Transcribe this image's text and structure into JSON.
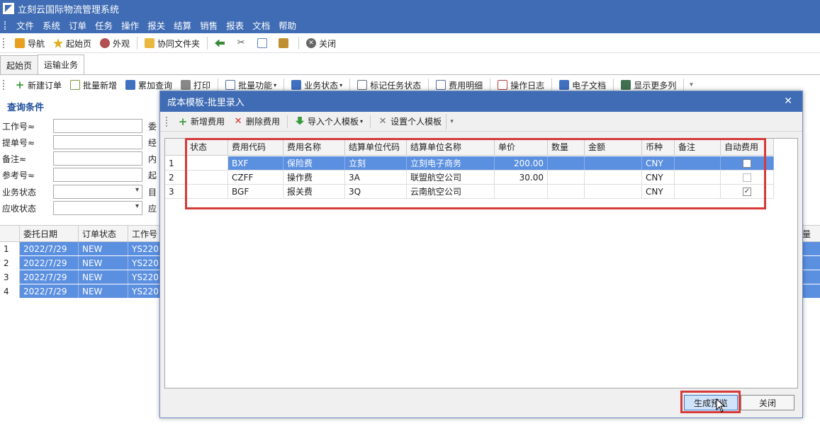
{
  "app": {
    "title": "立刻云国际物流管理系统",
    "menu": [
      "文件",
      "系统",
      "订单",
      "任务",
      "操作",
      "报关",
      "结算",
      "销售",
      "报表",
      "文档",
      "帮助"
    ]
  },
  "toolbar1": {
    "items": [
      {
        "label": "导航",
        "icon": "navigation-icon",
        "color": "#e8a020"
      },
      {
        "label": "起始页",
        "icon": "star-icon",
        "color": "#e0b020"
      },
      {
        "label": "外观",
        "icon": "palette-icon",
        "color": "#b05050"
      },
      {
        "label": "协同文件夹",
        "icon": "folder-icon",
        "color": "#e8b840"
      },
      {
        "label": "",
        "icon": "undo-icon",
        "color": "#3a8a3a"
      },
      {
        "label": "",
        "icon": "cut-icon",
        "color": "#555555"
      },
      {
        "label": "",
        "icon": "copy-icon",
        "color": "#6080c0"
      },
      {
        "label": "",
        "icon": "paste-icon",
        "color": "#c09030"
      },
      {
        "label": "关闭",
        "icon": "close-circle-icon",
        "color": "#666666"
      }
    ]
  },
  "tabs": [
    {
      "label": "起始页",
      "active": false
    },
    {
      "label": "运输业务",
      "active": true
    }
  ],
  "toolbar2": {
    "items": [
      {
        "label": "新建订单",
        "icon": "add-icon",
        "color": "#3a9a3a"
      },
      {
        "label": "批量新增",
        "icon": "batch-add-icon",
        "color": "#7a9a3a"
      },
      {
        "label": "累加查询",
        "icon": "search-icon",
        "color": "#4070c0"
      },
      {
        "label": "打印",
        "icon": "print-icon",
        "color": "#666666"
      },
      {
        "label": "批量功能",
        "icon": "batch-icon",
        "color": "#5070a0",
        "dropdown": true
      },
      {
        "label": "业务状态",
        "icon": "status-icon",
        "color": "#4070c0",
        "dropdown": true
      },
      {
        "label": "标记任务状态",
        "icon": "mark-icon",
        "color": "#607080"
      },
      {
        "label": "费用明细",
        "icon": "fee-detail-icon",
        "color": "#5070a0"
      },
      {
        "label": "操作日志",
        "icon": "log-icon",
        "color": "#c04040"
      },
      {
        "label": "电子文档",
        "icon": "document-icon",
        "color": "#4070c0"
      },
      {
        "label": "显示更多列",
        "icon": "columns-icon",
        "color": "#407050"
      }
    ]
  },
  "query": {
    "title": "查询条件",
    "rows": [
      {
        "label": "工作号≈",
        "label2": "委",
        "dropdown": false
      },
      {
        "label": "提单号≈",
        "label2": "经",
        "dropdown": false
      },
      {
        "label": "备注≈",
        "label2": "内",
        "dropdown": false
      },
      {
        "label": "参考号≈",
        "label2": "起",
        "dropdown": false
      },
      {
        "label": "业务状态",
        "label2": "目",
        "dropdown": true
      },
      {
        "label": "应收状态",
        "label2": "应",
        "dropdown": true
      }
    ]
  },
  "main_grid": {
    "headers": [
      "委托日期",
      "订单状态",
      "工作号"
    ],
    "right_header": "量",
    "rows": [
      {
        "n": "1",
        "date": "2022/7/29",
        "status": "NEW",
        "job": "YS220"
      },
      {
        "n": "2",
        "date": "2022/7/29",
        "status": "NEW",
        "job": "YS220"
      },
      {
        "n": "3",
        "date": "2022/7/29",
        "status": "NEW",
        "job": "YS220"
      },
      {
        "n": "4",
        "date": "2022/7/29",
        "status": "NEW",
        "job": "YS220"
      }
    ]
  },
  "dialog": {
    "title": "成本模板-批里录入",
    "close": "✕",
    "toolbar": [
      {
        "label": "新增费用",
        "icon": "add-icon",
        "color": "#3a9a3a"
      },
      {
        "label": "删除费用",
        "icon": "delete-icon",
        "color": "#d03030"
      },
      {
        "label": "导入个人模板",
        "icon": "import-icon",
        "color": "#3a9a3a",
        "dropdown": true
      },
      {
        "label": "设置个人模板",
        "icon": "settings-icon",
        "color": "#707070"
      }
    ],
    "columns": [
      "状态",
      "费用代码",
      "费用名称",
      "结算单位代码",
      "结算单位名称",
      "单价",
      "数量",
      "金额",
      "币种",
      "备注",
      "自动费用"
    ],
    "rows": [
      {
        "n": "1",
        "status": "",
        "code": "BXF",
        "name": "保险费",
        "unit_code": "立刻",
        "unit_name": "立刻电子商务",
        "price": "200.00",
        "qty": "",
        "amount": "",
        "currency": "CNY",
        "remark": "",
        "auto": false,
        "selected": true
      },
      {
        "n": "2",
        "status": "",
        "code": "CZFF",
        "name": "操作费",
        "unit_code": "3A",
        "unit_name": "联盟航空公司",
        "price": "30.00",
        "qty": "",
        "amount": "",
        "currency": "CNY",
        "remark": "",
        "auto": false,
        "selected": false
      },
      {
        "n": "3",
        "status": "",
        "code": "BGF",
        "name": "报关费",
        "unit_code": "3Q",
        "unit_name": "云南航空公司",
        "price": "",
        "qty": "",
        "amount": "",
        "currency": "CNY",
        "remark": "",
        "auto": true,
        "selected": false
      }
    ],
    "buttons": {
      "generate": "生成预览",
      "close": "关闭"
    }
  }
}
